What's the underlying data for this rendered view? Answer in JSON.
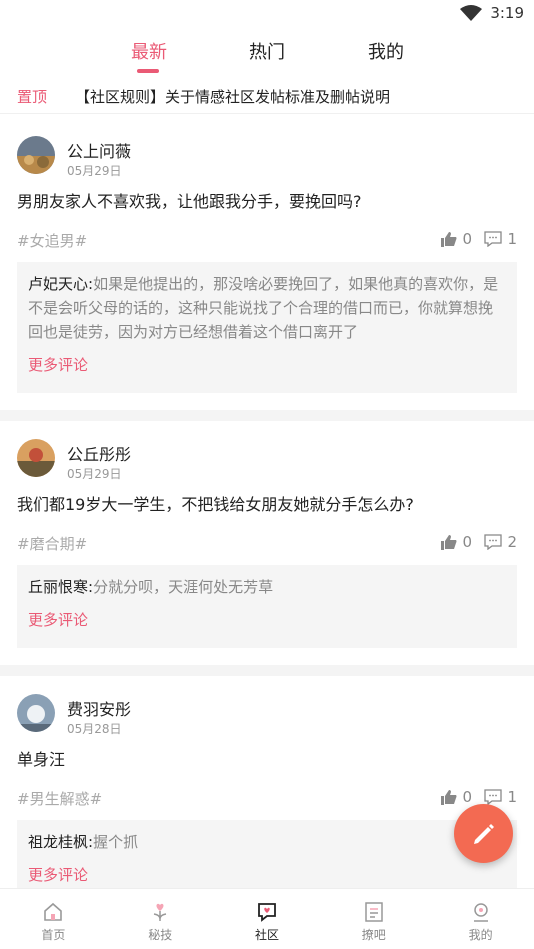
{
  "status": {
    "time": "3:19"
  },
  "tabs": [
    {
      "label": "最新",
      "active": true
    },
    {
      "label": "热门",
      "active": false
    },
    {
      "label": "我的",
      "active": false
    }
  ],
  "pinned": {
    "tag": "置顶",
    "text": "【社区规则】关于情感社区发帖标准及删帖说明"
  },
  "posts": [
    {
      "user": "公上问薇",
      "date": "05月29日",
      "content": "男朋友家人不喜欢我，让他跟我分手，要挽回吗?",
      "topic": "#女追男#",
      "likes": "0",
      "comments": "1",
      "comment_user": "卢妃天心:",
      "comment_text": "如果是他提出的，那没啥必要挽回了，如果他真的喜欢你，是不是会听父母的话的，这种只能说找了个合理的借口而已，你就算想挽回也是徒劳，因为对方已经想借着这个借口离开了",
      "more": "更多评论"
    },
    {
      "user": "公丘彤彤",
      "date": "05月29日",
      "content": "我们都19岁大一学生，不把钱给女朋友她就分手怎么办?",
      "topic": "#磨合期#",
      "likes": "0",
      "comments": "2",
      "comment_user": "丘丽恨寒:",
      "comment_text": "分就分呗，天涯何处无芳草",
      "more": "更多评论"
    },
    {
      "user": "费羽安彤",
      "date": "05月28日",
      "content": "单身汪",
      "topic": "#男生解惑#",
      "likes": "0",
      "comments": "1",
      "comment_user": "祖龙桂枫:",
      "comment_text": "握个抓",
      "more": "更多评论"
    }
  ],
  "nav": [
    {
      "label": "首页",
      "icon": "home-icon"
    },
    {
      "label": "秘技",
      "icon": "heart-sprout-icon"
    },
    {
      "label": "社区",
      "icon": "community-heart-icon",
      "active": true
    },
    {
      "label": "撩吧",
      "icon": "list-icon"
    },
    {
      "label": "我的",
      "icon": "profile-icon"
    }
  ],
  "colors": {
    "accent": "#ea5a75",
    "fab": "#f36a52"
  }
}
